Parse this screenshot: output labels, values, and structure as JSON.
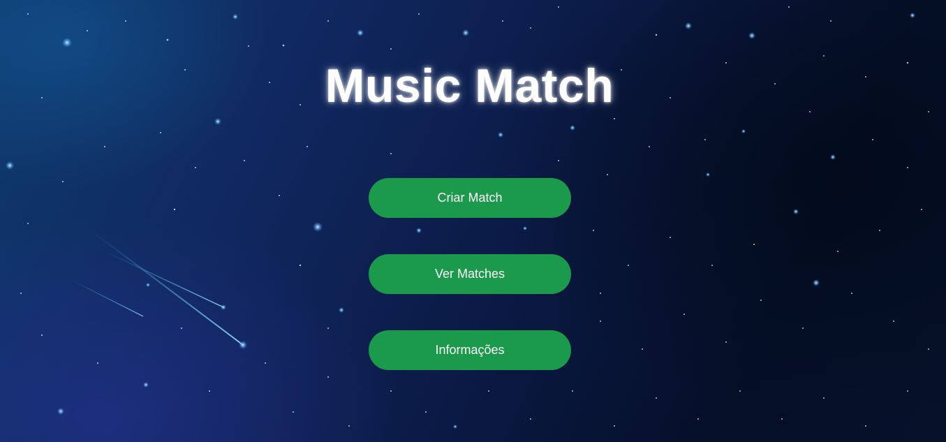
{
  "page": {
    "title": "Music Match"
  },
  "menu": {
    "buttons": [
      {
        "label": "Criar Match"
      },
      {
        "label": "Ver Matches"
      },
      {
        "label": "Informações"
      }
    ]
  },
  "colors": {
    "button_background": "#1a9a4a",
    "button_text": "#ffffff",
    "title_text": "#ffffff",
    "background_dark": "#050f28",
    "background_blue": "#10275e"
  }
}
